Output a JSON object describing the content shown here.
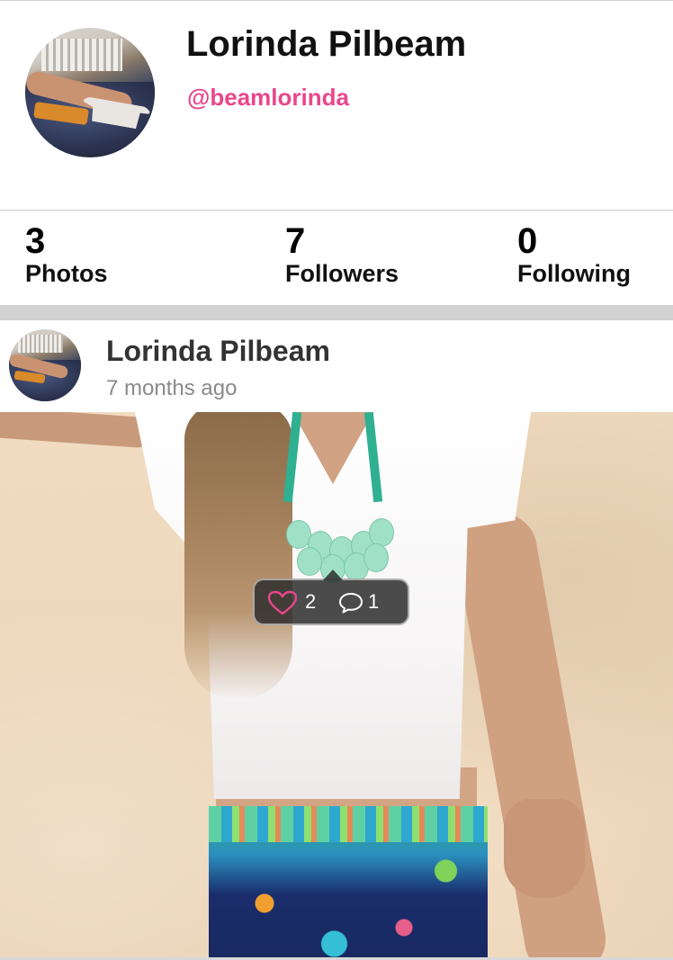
{
  "profile": {
    "display_name": "Lorinda Pilbeam",
    "handle": "@beamlorinda",
    "avatar_icon": "profile-photo-avatar",
    "handle_color": "#e8478b"
  },
  "stats": [
    {
      "value": "3",
      "label": "Photos"
    },
    {
      "value": "7",
      "label": "Followers"
    },
    {
      "value": "0",
      "label": "Following"
    }
  ],
  "post": {
    "author": "Lorinda Pilbeam",
    "time": "7 months ago",
    "likes": "2",
    "comments": "1",
    "like_icon": "heart-outline-icon",
    "comment_icon": "speech-bubble-icon",
    "like_icon_color": "#e8478b"
  }
}
